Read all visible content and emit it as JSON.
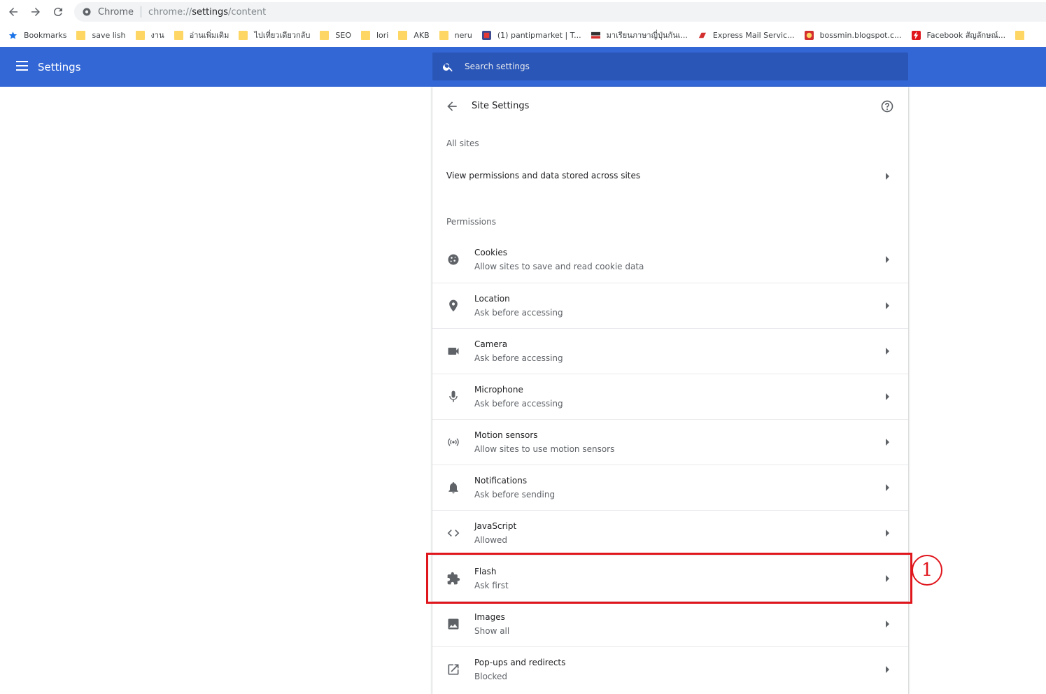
{
  "browser": {
    "site_label": "Chrome",
    "url_prefix": "chrome://",
    "url_host": "settings",
    "url_path": "/content"
  },
  "bookmarks": [
    {
      "label": "Bookmarks",
      "icon": "star-icon"
    },
    {
      "label": "save lish",
      "icon": "folder-icon"
    },
    {
      "label": "งาน",
      "icon": "folder-icon"
    },
    {
      "label": "อ่านเพิ่มเติม",
      "icon": "folder-icon"
    },
    {
      "label": "ไปเที่ยวเดียวกลับ",
      "icon": "folder-icon"
    },
    {
      "label": "SEO",
      "icon": "folder-icon"
    },
    {
      "label": "lori",
      "icon": "folder-icon"
    },
    {
      "label": "AKB",
      "icon": "folder-icon"
    },
    {
      "label": "neru",
      "icon": "folder-icon"
    },
    {
      "label": "(1) pantipmarket | T...",
      "icon": "pantip-favicon"
    },
    {
      "label": "มาเรียนภาษาญี่ปุ่นกันเ...",
      "icon": "nhk-favicon"
    },
    {
      "label": "Express Mail Servic...",
      "icon": "ems-favicon"
    },
    {
      "label": "bossmin.blogspot.c...",
      "icon": "blogspot-favicon"
    },
    {
      "label": "Facebook สัญลักษณ์...",
      "icon": "bolt-favicon"
    }
  ],
  "header": {
    "title": "Settings",
    "search_placeholder": "Search settings"
  },
  "site_settings": {
    "title": "Site Settings",
    "all_sites_label": "All sites",
    "all_sites_link": "View permissions and data stored across sites",
    "permissions_label": "Permissions",
    "permissions": [
      {
        "name": "Cookies",
        "status": "Allow sites to save and read cookie data",
        "icon": "cookie-icon"
      },
      {
        "name": "Location",
        "status": "Ask before accessing",
        "icon": "location-pin-icon"
      },
      {
        "name": "Camera",
        "status": "Ask before accessing",
        "icon": "camera-icon"
      },
      {
        "name": "Microphone",
        "status": "Ask before accessing",
        "icon": "microphone-icon"
      },
      {
        "name": "Motion sensors",
        "status": "Allow sites to use motion sensors",
        "icon": "motion-sensor-icon"
      },
      {
        "name": "Notifications",
        "status": "Ask before sending",
        "icon": "bell-icon"
      },
      {
        "name": "JavaScript",
        "status": "Allowed",
        "icon": "code-icon"
      },
      {
        "name": "Flash",
        "status": "Ask first",
        "icon": "puzzle-icon"
      },
      {
        "name": "Images",
        "status": "Show all",
        "icon": "image-icon"
      },
      {
        "name": "Pop-ups and redirects",
        "status": "Blocked",
        "icon": "open-in-new-icon"
      }
    ]
  },
  "annotation": {
    "number": "1",
    "color": "#e0161d"
  },
  "colors": {
    "header_bg": "#3367d6",
    "search_bg": "#2a56b8"
  }
}
